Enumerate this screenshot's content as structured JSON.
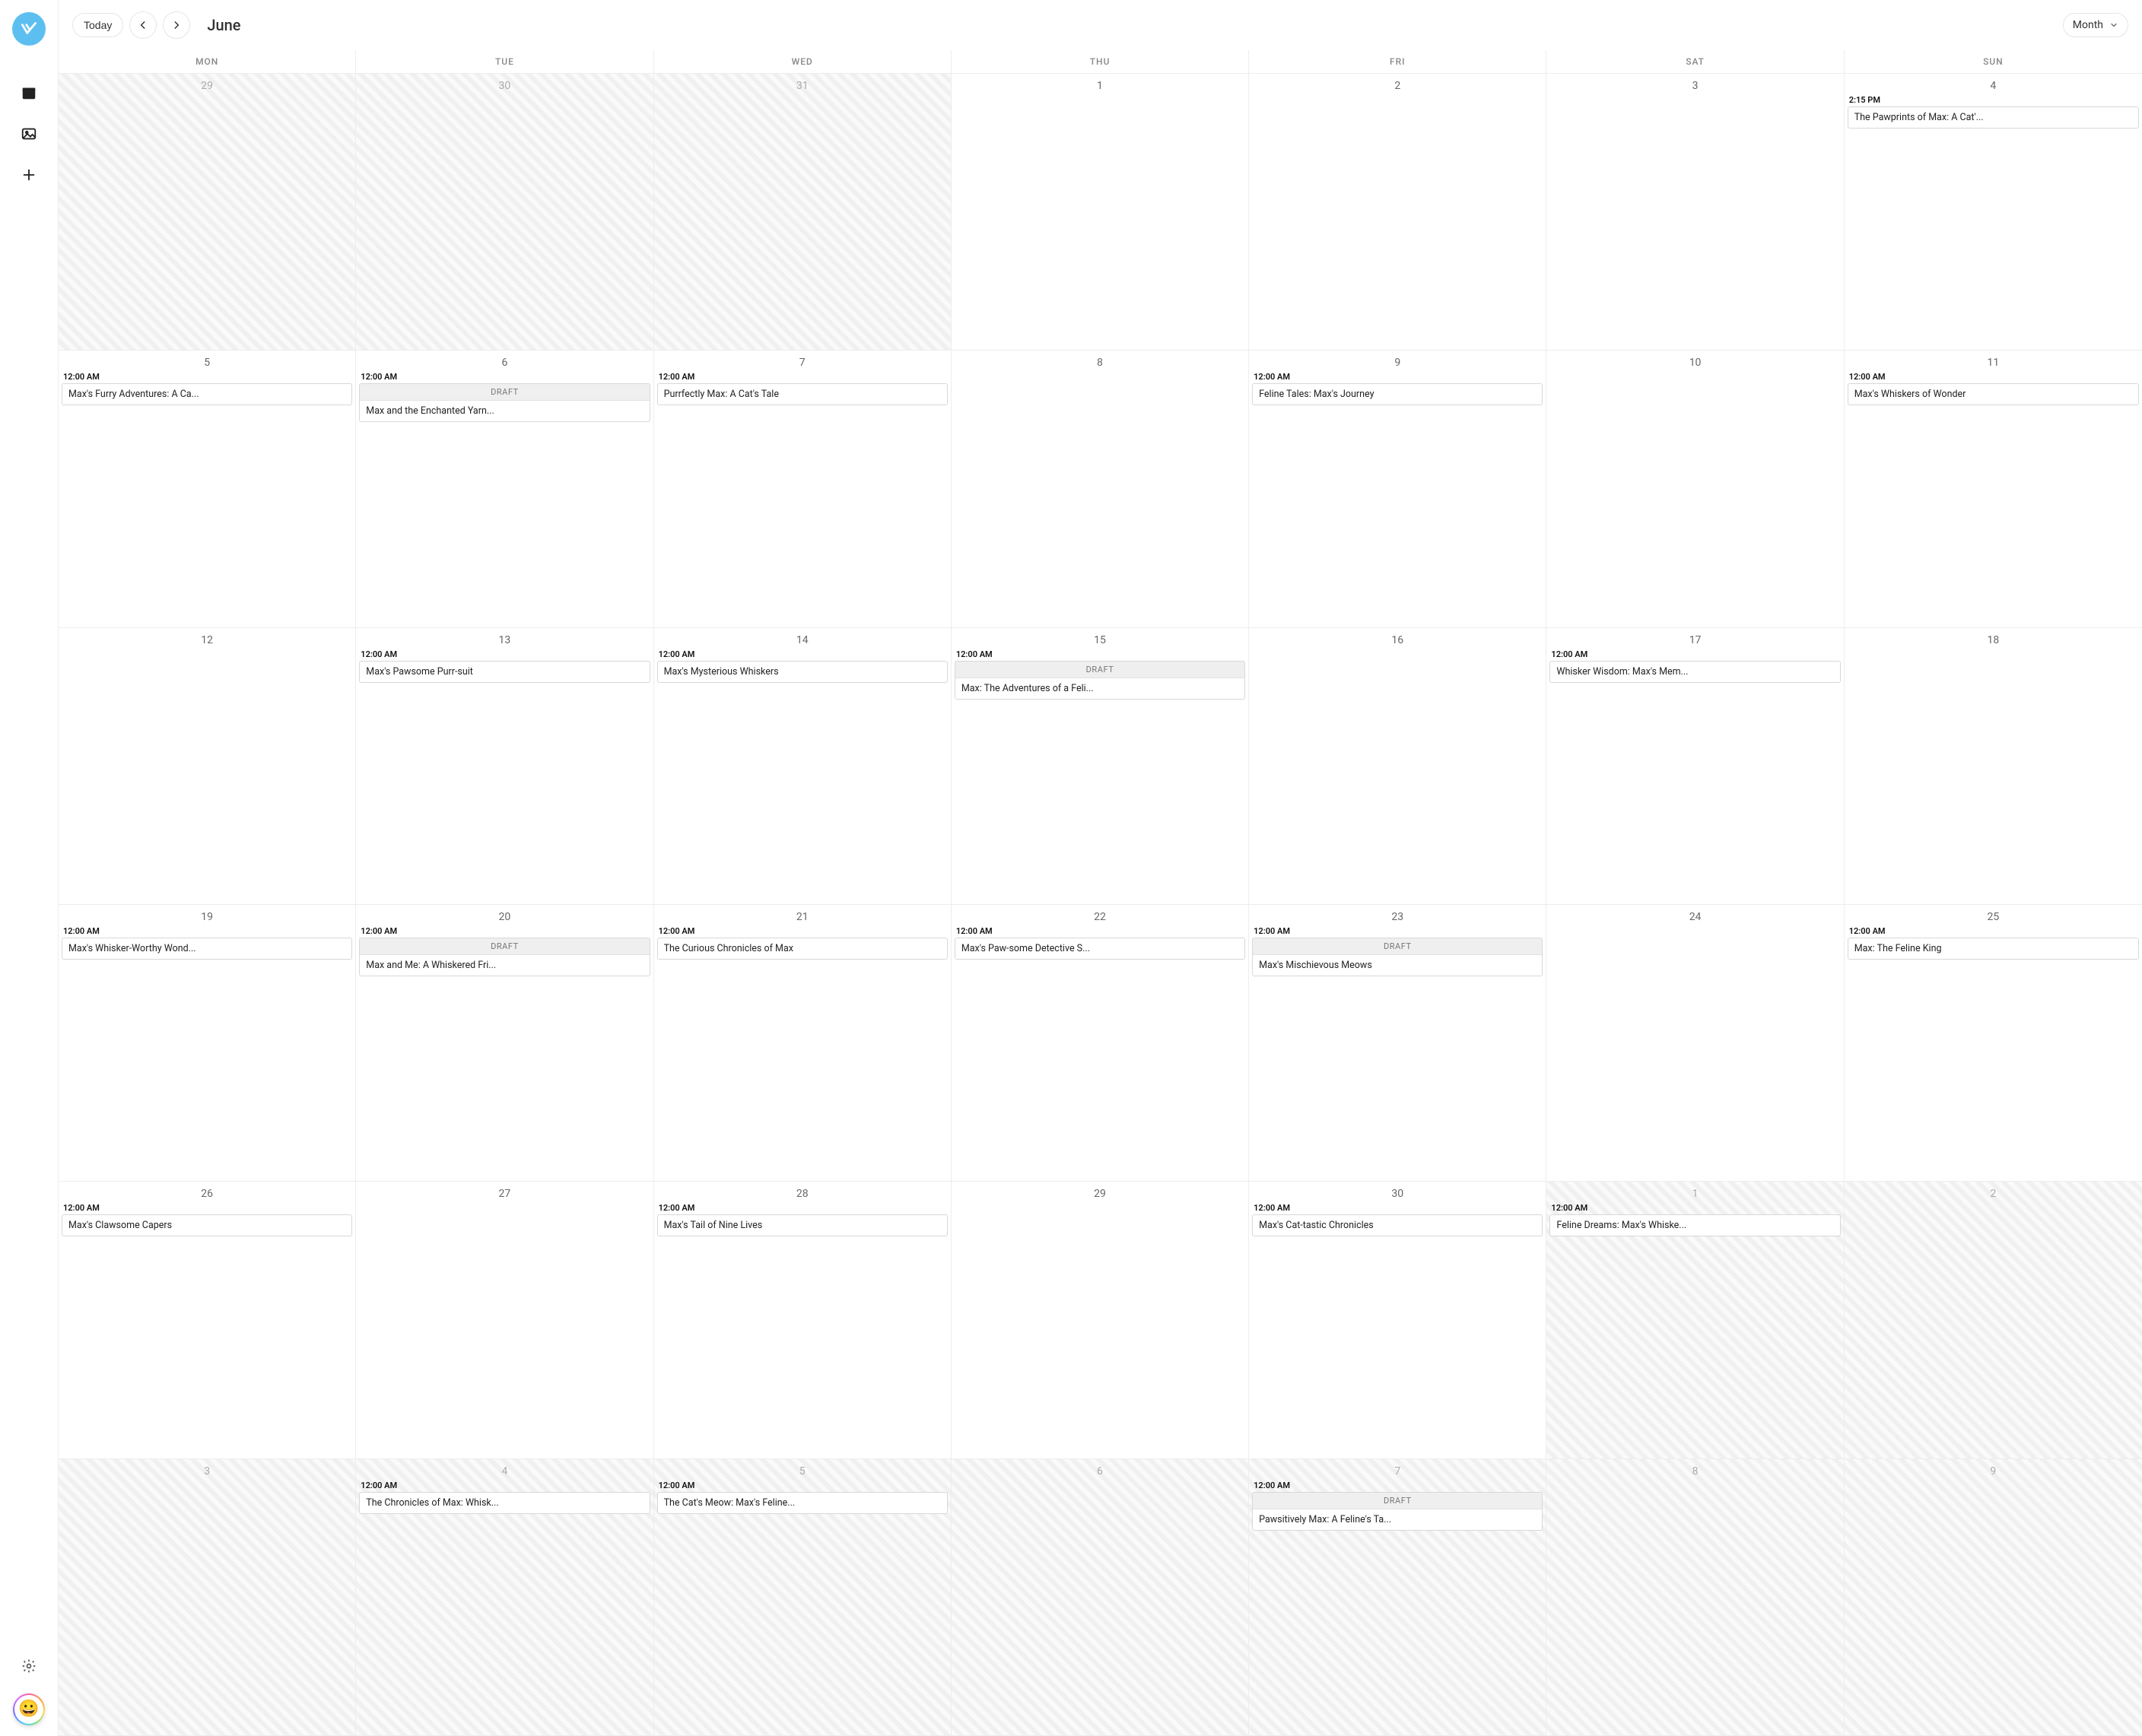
{
  "sidebar": {
    "nav_items": [
      "calendar",
      "image",
      "plus"
    ]
  },
  "header": {
    "today_label": "Today",
    "month_title": "June",
    "view_label": "Month"
  },
  "day_names": [
    "MON",
    "TUE",
    "WED",
    "THU",
    "FRI",
    "SAT",
    "SUN"
  ],
  "draft_label": "DRAFT",
  "cells": [
    {
      "date": "29",
      "out": true
    },
    {
      "date": "30",
      "out": true
    },
    {
      "date": "31",
      "out": true
    },
    {
      "date": "1"
    },
    {
      "date": "2"
    },
    {
      "date": "3"
    },
    {
      "date": "4",
      "events": [
        {
          "time": "2:15 PM",
          "title": "The Pawprints of Max: A Cat'..."
        }
      ]
    },
    {
      "date": "5",
      "events": [
        {
          "time": "12:00 AM",
          "title": "Max's Furry Adventures: A Ca..."
        }
      ]
    },
    {
      "date": "6",
      "events": [
        {
          "time": "12:00 AM",
          "draft": true,
          "title": "Max and the Enchanted Yarn..."
        }
      ]
    },
    {
      "date": "7",
      "events": [
        {
          "time": "12:00 AM",
          "title": "Purrfectly Max: A Cat's Tale"
        }
      ]
    },
    {
      "date": "8"
    },
    {
      "date": "9",
      "events": [
        {
          "time": "12:00 AM",
          "title": "Feline Tales: Max's Journey"
        }
      ]
    },
    {
      "date": "10"
    },
    {
      "date": "11",
      "events": [
        {
          "time": "12:00 AM",
          "title": "Max's Whiskers of Wonder"
        }
      ]
    },
    {
      "date": "12"
    },
    {
      "date": "13",
      "events": [
        {
          "time": "12:00 AM",
          "title": "Max's Pawsome Purr-suit"
        }
      ]
    },
    {
      "date": "14",
      "events": [
        {
          "time": "12:00 AM",
          "title": "Max's Mysterious Whiskers"
        }
      ]
    },
    {
      "date": "15",
      "events": [
        {
          "time": "12:00 AM",
          "draft": true,
          "title": "Max: The Adventures of a Feli..."
        }
      ]
    },
    {
      "date": "16"
    },
    {
      "date": "17",
      "events": [
        {
          "time": "12:00 AM",
          "title": "Whisker Wisdom: Max's Mem..."
        }
      ]
    },
    {
      "date": "18"
    },
    {
      "date": "19",
      "events": [
        {
          "time": "12:00 AM",
          "title": "Max's Whisker-Worthy Wond..."
        }
      ]
    },
    {
      "date": "20",
      "events": [
        {
          "time": "12:00 AM",
          "draft": true,
          "title": "Max and Me: A Whiskered Fri..."
        }
      ]
    },
    {
      "date": "21",
      "events": [
        {
          "time": "12:00 AM",
          "title": "The Curious Chronicles of Max"
        }
      ]
    },
    {
      "date": "22",
      "events": [
        {
          "time": "12:00 AM",
          "title": "Max's Paw-some Detective S..."
        }
      ]
    },
    {
      "date": "23",
      "events": [
        {
          "time": "12:00 AM",
          "draft": true,
          "title": "Max's Mischievous Meows"
        }
      ]
    },
    {
      "date": "24"
    },
    {
      "date": "25",
      "events": [
        {
          "time": "12:00 AM",
          "title": "Max: The Feline King"
        }
      ]
    },
    {
      "date": "26",
      "events": [
        {
          "time": "12:00 AM",
          "title": "Max's Clawsome Capers"
        }
      ]
    },
    {
      "date": "27"
    },
    {
      "date": "28",
      "events": [
        {
          "time": "12:00 AM",
          "title": "Max's Tail of Nine Lives"
        }
      ]
    },
    {
      "date": "29"
    },
    {
      "date": "30",
      "events": [
        {
          "time": "12:00 AM",
          "title": "Max's Cat-tastic Chronicles"
        }
      ]
    },
    {
      "date": "1",
      "out": true,
      "events": [
        {
          "time": "12:00 AM",
          "title": "Feline Dreams: Max's Whiske..."
        }
      ]
    },
    {
      "date": "2",
      "out": true
    },
    {
      "date": "3",
      "out": true
    },
    {
      "date": "4",
      "out": true,
      "events": [
        {
          "time": "12:00 AM",
          "title": "The Chronicles of Max: Whisk..."
        }
      ]
    },
    {
      "date": "5",
      "out": true,
      "events": [
        {
          "time": "12:00 AM",
          "title": "The Cat's Meow: Max's Feline..."
        }
      ]
    },
    {
      "date": "6",
      "out": true
    },
    {
      "date": "7",
      "out": true,
      "events": [
        {
          "time": "12:00 AM",
          "draft": true,
          "title": "Pawsitively Max: A Feline's Ta..."
        }
      ]
    },
    {
      "date": "8",
      "out": true
    },
    {
      "date": "9",
      "out": true
    }
  ]
}
